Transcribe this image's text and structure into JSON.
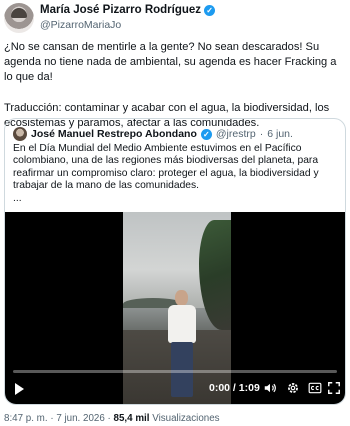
{
  "author": {
    "name": "María José Pizarro Rodríguez",
    "handle": "@PizarroMariaJo",
    "verified": true
  },
  "tweet": {
    "paragraphs": [
      "¿No se cansan de mentirle a la gente? No sean descarados! Su agenda no tiene nada de ambiental, su agenda es hacer Fracking a lo que da!",
      "Traducción: contaminar y acabar con el agua, la biodiversidad, los ecosistemas y paramos, afectar a las comunidades."
    ]
  },
  "quoted": {
    "name": "José Manuel Restrepo Abondano",
    "handle": "@jrestrp",
    "separator": "·",
    "date": "6 jun.",
    "verified": true,
    "text": "En el Día Mundial del Medio Ambiente estuvimos en el Pacífico colombiano, una de las regiones más biodiversas del planeta, para reafirmar un compromiso claro: proteger el agua, la biodiversidad y trabajar de la mano de las comunidades.",
    "ellipsis": "...",
    "video": {
      "time": "0:00 / 1:09",
      "progress": 0.0
    }
  },
  "footer": {
    "time": "8:47 p. m.",
    "dot": "·",
    "date": "7 jun. 2026",
    "dot2": "·",
    "views": "85,4 mil",
    "views_label": "Visualizaciones"
  },
  "colors": {
    "accent": "#1d9bf0",
    "text": "#0f1419",
    "muted": "#536471"
  },
  "icons": [
    "verified-icon",
    "play-icon",
    "volume-icon",
    "settings-icon",
    "subtitles-icon",
    "fullscreen-icon"
  ]
}
